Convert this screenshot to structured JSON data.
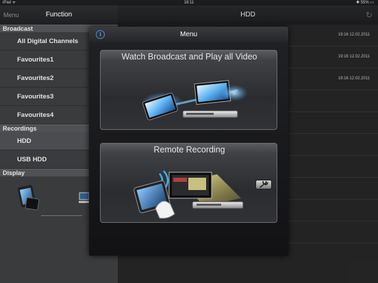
{
  "status_bar": {
    "carrier": "iPad ᯤ",
    "time": "18:11",
    "battery": "✱ 55% ▭"
  },
  "left_pane": {
    "menu_button": "Menu",
    "title": "Function",
    "sections": [
      {
        "header": "Broadcast",
        "items": [
          "All Digital Channels",
          "Favourites1",
          "Favourites2",
          "Favourites3",
          "Favourites4"
        ]
      },
      {
        "header": "Recordings",
        "items": [
          "HDD",
          "USB HDD"
        ],
        "selected": "HDD"
      },
      {
        "header": "Display",
        "items": []
      }
    ]
  },
  "right_pane": {
    "title": "HDD",
    "refresh_icon": "refresh-icon",
    "rows": [
      {
        "date": "19:16 12.02.2011"
      },
      {
        "date": "19:16 12.02.2011"
      },
      {
        "date": "19:16 12.02.2011"
      },
      {
        "date": ""
      },
      {
        "date": ""
      },
      {
        "date": ""
      },
      {
        "date": ""
      },
      {
        "date": ""
      },
      {
        "date": ""
      },
      {
        "date": ""
      }
    ]
  },
  "modal": {
    "title": "Menu",
    "info_icon": "info-icon",
    "cards": [
      {
        "label": "Watch Broadcast and Play all Video"
      },
      {
        "label": "Remote Recording"
      }
    ],
    "wrench_icon": "wrench-icon"
  },
  "colors": {
    "accent_blue": "#4d8ff0",
    "modal_bg": "#000000",
    "pane_bg": "#3a3b3d"
  }
}
